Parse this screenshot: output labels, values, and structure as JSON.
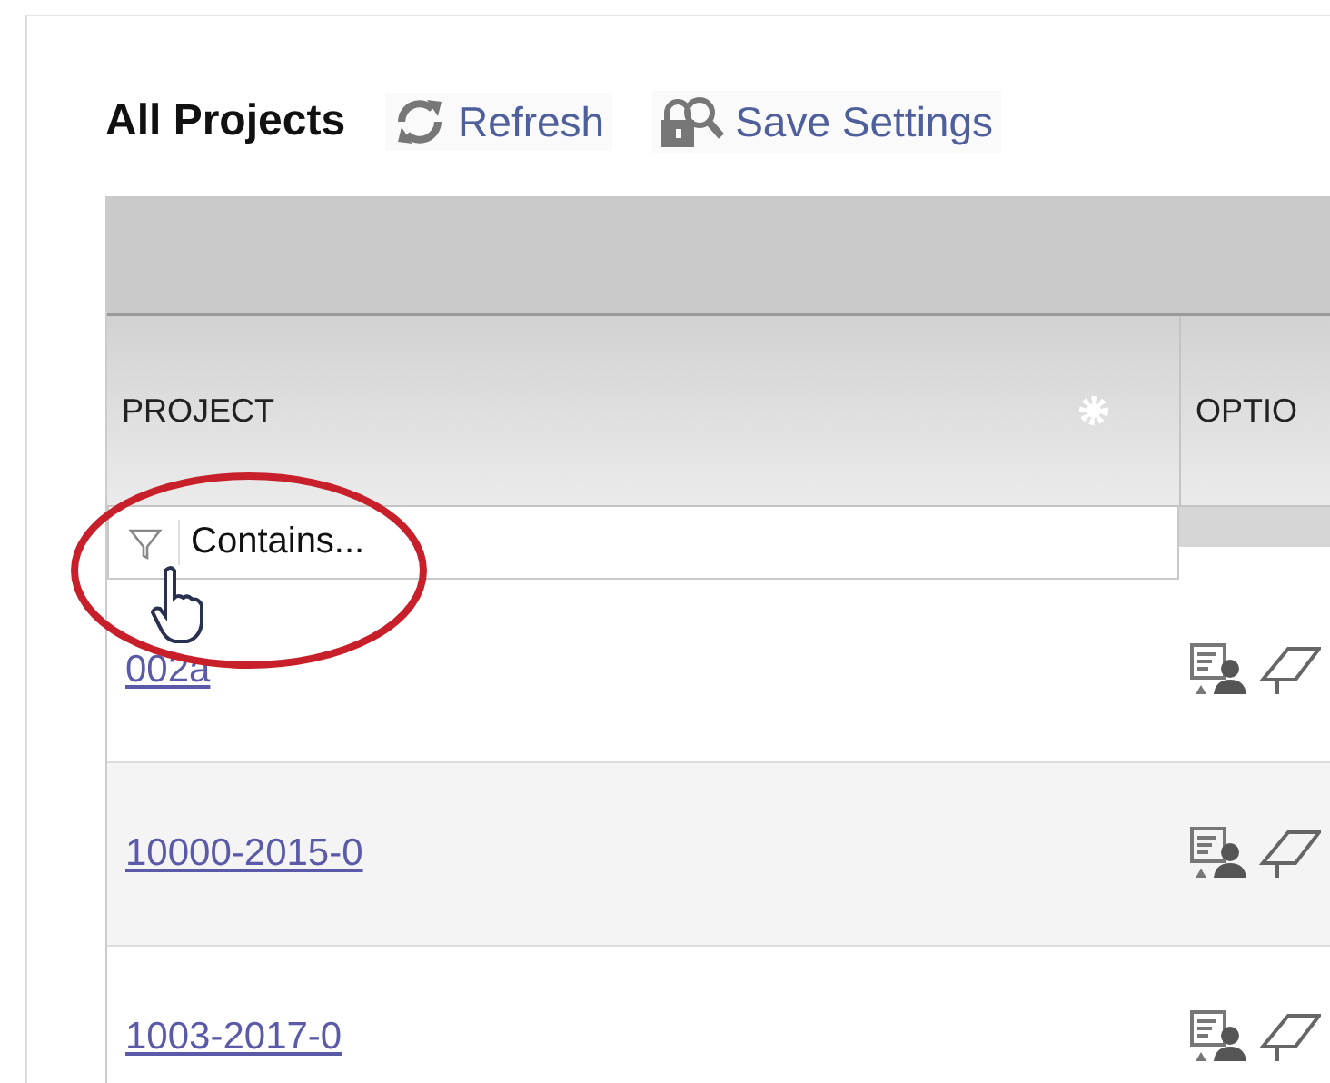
{
  "header": {
    "title": "All Projects",
    "actions": [
      {
        "label": "Refresh",
        "kind": "refresh"
      },
      {
        "label": "Save Settings",
        "kind": "save"
      }
    ]
  },
  "table": {
    "columns": [
      {
        "label": "PROJECT",
        "has_menu": true
      },
      {
        "label": "OPTIO",
        "has_menu": false
      }
    ],
    "filter": {
      "placeholder": "Contains..."
    },
    "rows": [
      {
        "project": "002a"
      },
      {
        "project": "10000-2015-0"
      },
      {
        "project": "1003-2017-0"
      }
    ]
  }
}
